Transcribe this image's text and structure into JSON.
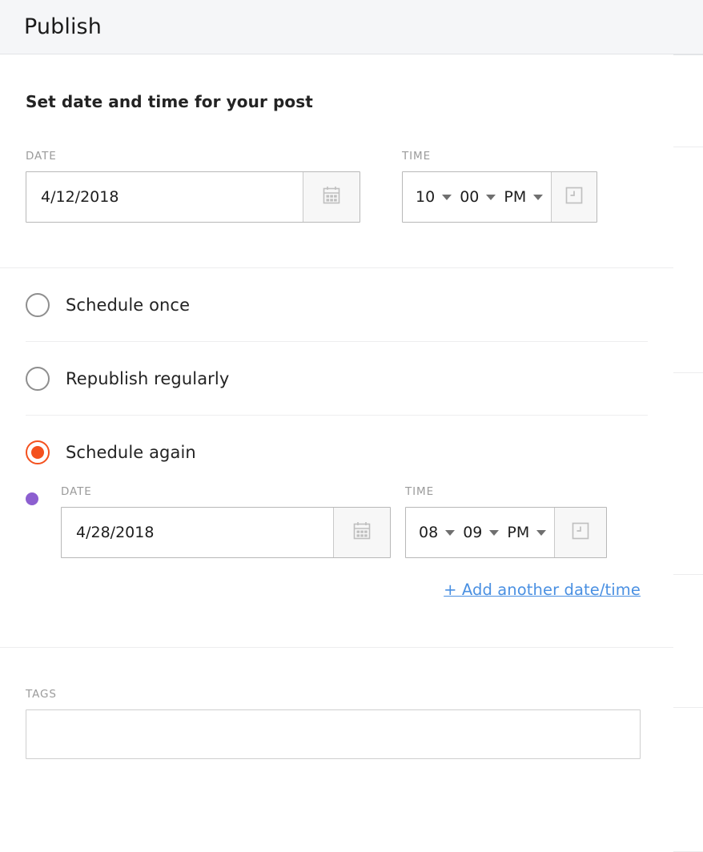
{
  "header": {
    "title": "Publish"
  },
  "datetime_section": {
    "heading": "Set date and time for your post",
    "date_label": "DATE",
    "date_value": "4/12/2018",
    "date_icon": "calendar-icon",
    "time_label": "TIME",
    "time_hour": "10",
    "time_minute": "00",
    "time_meridiem": "PM",
    "time_icon": "clock-icon"
  },
  "schedule_options": [
    {
      "label": "Schedule once",
      "selected": false
    },
    {
      "label": "Republish regularly",
      "selected": false
    },
    {
      "label": "Schedule again",
      "selected": true
    }
  ],
  "occurrence": {
    "marker_color": "#8c5fd0",
    "date_label": "DATE",
    "date_value": "4/28/2018",
    "date_icon": "calendar-icon",
    "time_label": "TIME",
    "time_hour": "08",
    "time_minute": "09",
    "time_meridiem": "PM",
    "time_icon": "clock-icon",
    "add_link": "+ Add another date/time"
  },
  "tags_section": {
    "label": "TAGS",
    "value": "",
    "placeholder": ""
  },
  "colors": {
    "accent_selected": "#f4511e",
    "marker_purple": "#8c5fd0",
    "link_blue": "#4a90e2",
    "header_bg": "#f5f6f8",
    "label_gray": "#9b9b9b"
  }
}
